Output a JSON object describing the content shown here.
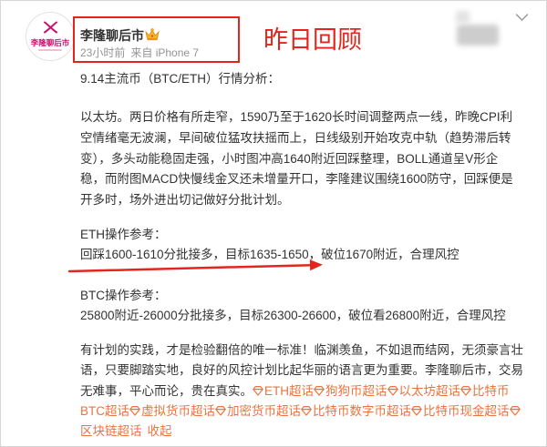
{
  "colors": {
    "text": "#333333",
    "meta_gray": "#939393",
    "topic_orange": "#eb7340",
    "annotation_red": "#e3261d",
    "avatar_pink": "#c8106e",
    "badge_gold": "#f4b625"
  },
  "icons": {
    "avatar_logo": "x-logo-icon",
    "badge": "crown-icon",
    "menu": "chevron-down-icon",
    "topic": "super-topic-icon"
  },
  "post": {
    "author": {
      "name": "李隆聊后市",
      "avatar_label": "李隆聊后市"
    },
    "meta": {
      "time": "23小时前",
      "source": "来自 iPhone 7"
    },
    "title": "9.14主流币（BTC/ETH）行情分析：",
    "analysis_lines": [
      "以太坊。两日价格有所走窄，1590乃至于1620长时间调整两点一线，昨晚CPI利",
      "空情绪毫无波澜，早间破位猛攻扶摇而上，日线级别开始攻克中轨（趋势滞后转",
      "变），多头动能稳固走强，小时图冲高1640附近回踩整理，BOLL通道呈V形企",
      "稳，而附图MACD快慢线金叉还未增量开口，李隆建议围绕1600防守，回踩便是",
      "开多时，场外进出切记做好分批计划。"
    ],
    "eth": {
      "heading": "ETH操作参考：",
      "plan": "回踩1600-1610分批接多，目标1635-1650，破位1670附近，合理风控"
    },
    "btc": {
      "heading": "BTC操作参考：",
      "plan": "25800附近-26000分批接多，目标26300-26600，破位看26800附近，合理风控"
    },
    "closing_lines": [
      "有计划的实践，才是检验翻倍的唯一标准！临渊羡鱼，不如退而结网，无须豪言壮",
      "语，只要脚踏实地，良好的风控计划比起华丽的语言更为重要。李隆聊后市，交易"
    ],
    "closing_tail": "无难事，平心而论，贵在真实。",
    "topics": [
      "ETH超话",
      "狗狗币超话",
      "以太坊超话",
      "比特币BTC超话",
      "虚拟货币超话",
      "加密货币超话",
      "比特币数字币超话",
      "比特币现金超话",
      "区块链超话"
    ],
    "collapse_label": "收起"
  },
  "annotations": {
    "label": "昨日回顾"
  }
}
